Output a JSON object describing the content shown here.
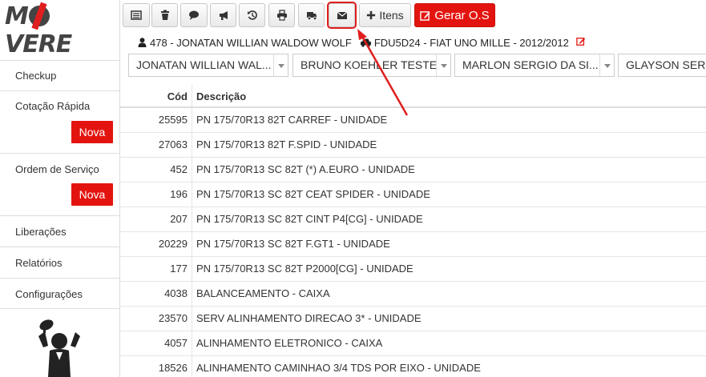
{
  "brand": {
    "logo_text_pre": "M",
    "logo_text_post": "VERE"
  },
  "sidebar": {
    "items": [
      {
        "label": "Checkup"
      },
      {
        "label": "Cotação Rápida",
        "badge": "Nova"
      },
      {
        "label": "Ordem de Serviço",
        "badge": "Nova"
      },
      {
        "label": "Liberações"
      },
      {
        "label": "Relatórios"
      },
      {
        "label": "Configurações"
      }
    ]
  },
  "toolbar": {
    "buttons": [
      {
        "icon": "list-icon"
      },
      {
        "icon": "trash-icon"
      },
      {
        "icon": "comment-icon"
      },
      {
        "icon": "megaphone-icon"
      },
      {
        "icon": "history-icon"
      },
      {
        "icon": "print-icon"
      },
      {
        "icon": "truck-icon"
      },
      {
        "icon": "envelope-icon",
        "highlighted": true
      },
      {
        "icon": "plus-icon",
        "label": "Itens"
      },
      {
        "icon": "edit-icon",
        "label": "Gerar O.S"
      }
    ],
    "highlight_color": "#e01e1e",
    "accent_red": "#e3140f"
  },
  "client": {
    "customer": "478 - JONATAN WILLIAN WALDOW WOLF",
    "vehicle": "FDU5D24 - FIAT UNO MILLE - 2012/2012"
  },
  "selects": [
    {
      "value": "JONATAN WILLIAN WAL..."
    },
    {
      "value": "BRUNO KOEHLER TESTE"
    },
    {
      "value": "MARLON SERGIO DA SI..."
    },
    {
      "value": "GLAYSON SERG"
    }
  ],
  "table": {
    "headers": {
      "cod": "Cód",
      "desc": "Descrição"
    },
    "rows": [
      {
        "cod": "25595",
        "desc": "PN 175/70R13 82T CARREF - UNIDADE"
      },
      {
        "cod": "27063",
        "desc": "PN 175/70R13 82T F.SPID - UNIDADE"
      },
      {
        "cod": "452",
        "desc": "PN 175/70R13 SC 82T (*) A.EURO - UNIDADE"
      },
      {
        "cod": "196",
        "desc": "PN 175/70R13 SC 82T CEAT SPIDER - UNIDADE"
      },
      {
        "cod": "207",
        "desc": "PN 175/70R13 SC 82T CINT P4[CG] - UNIDADE"
      },
      {
        "cod": "20229",
        "desc": "PN 175/70R13 SC 82T F.GT1 - UNIDADE"
      },
      {
        "cod": "177",
        "desc": "PN 175/70R13 SC 82T P2000[CG] - UNIDADE"
      },
      {
        "cod": "4038",
        "desc": "BALANCEAMENTO - CAIXA"
      },
      {
        "cod": "23570",
        "desc": "SERV ALINHAMENTO DIRECAO 3* - UNIDADE"
      },
      {
        "cod": "4057",
        "desc": "ALINHAMENTO ELETRONICO - CAIXA"
      },
      {
        "cod": "18526",
        "desc": "ALINHAMENTO CAMINHAO 3/4 TDS POR EIXO - UNIDADE"
      }
    ]
  }
}
